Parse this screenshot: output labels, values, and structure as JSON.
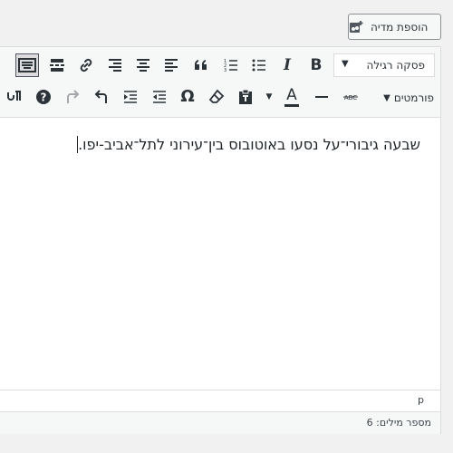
{
  "media_button": {
    "label": "הוספת מדיה",
    "icon": "add-media-icon"
  },
  "toolbar": {
    "format_select": {
      "selected": "פסקה רגילה"
    },
    "formats_label": "פורמטים",
    "text_color_letter": "A",
    "text_color_accent": "#2c3338",
    "row1_icons": [
      "toolbar-toggle-icon",
      "read-more-icon",
      "link-icon",
      "align-right-icon",
      "align-center-icon",
      "align-left-icon",
      "blockquote-icon",
      "numbered-list-icon",
      "bullet-list-icon",
      "italic-icon",
      "bold-icon"
    ],
    "row2_icons": [
      "rtl-direction-icon",
      "help-icon",
      "redo-icon",
      "undo-icon",
      "indent-icon",
      "outdent-icon",
      "special-character-icon",
      "clear-formatting-icon",
      "paste-as-text-icon",
      "text-color-icon",
      "horizontal-line-icon",
      "strikethrough-icon"
    ]
  },
  "editor": {
    "content": "שבעה גיבורי־על נסעו באוטובוס בין־עירוני לתל־אביב-יפו."
  },
  "path_bar": {
    "element": "p"
  },
  "status_bar": {
    "word_count": "מספר מילים: 6"
  }
}
